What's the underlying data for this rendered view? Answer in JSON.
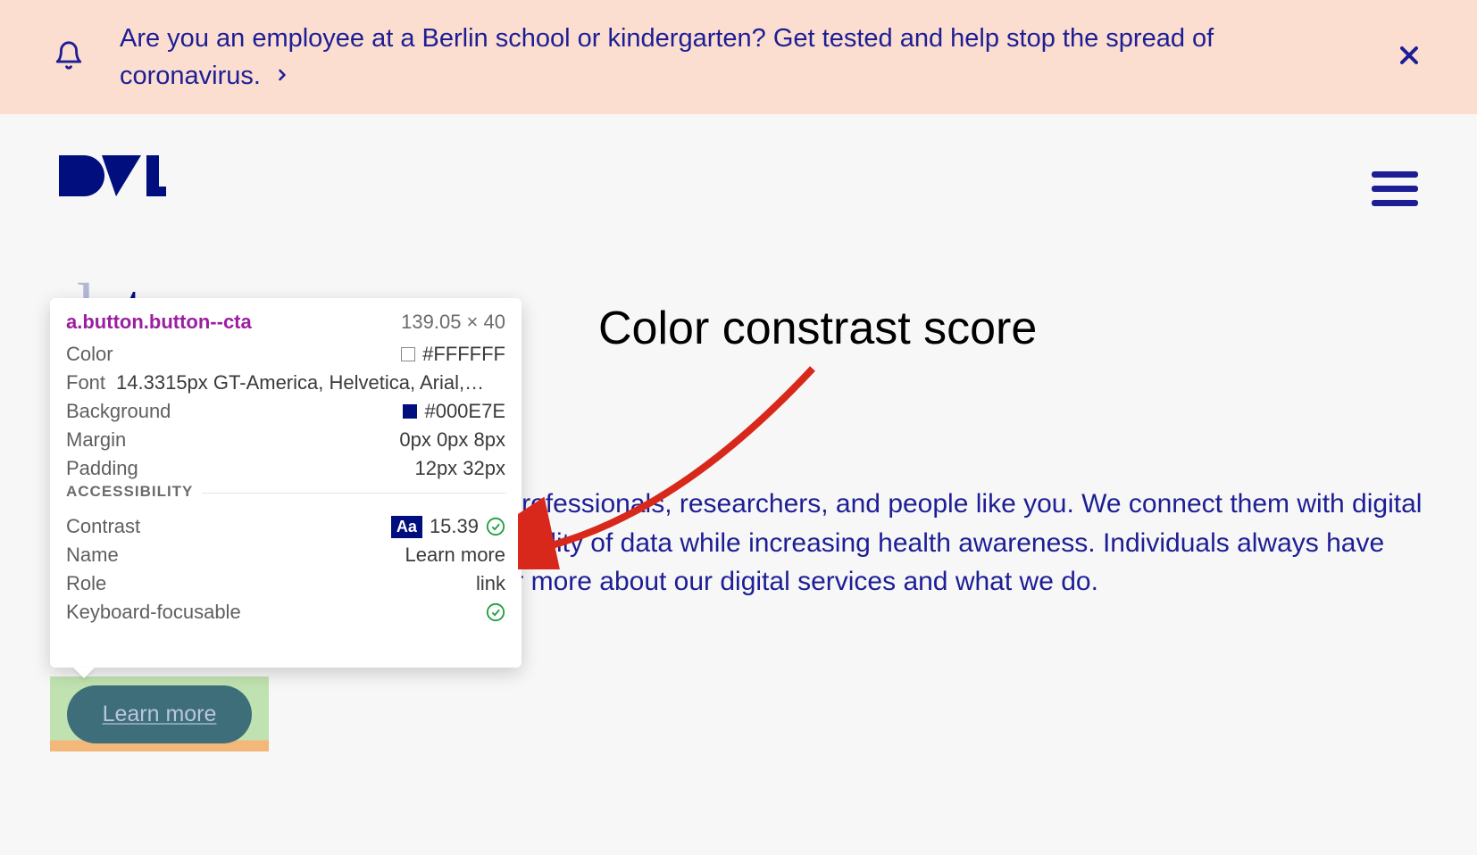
{
  "banner": {
    "message": "Are you an employee at a Berlin school or kindergarten? Get tested and help stop the spread of coronavirus."
  },
  "logo": {
    "text": "D4L"
  },
  "hero": {
    "heading_light": "da",
    "heading_strong": "ta",
    "body": "We build bridges between healthcare professionals, researchers, and people like you. We connect them with digital solutions that improve the secure availability of data while increasing health awareness. Individuals always have complete control of their data. Discover more about our digital services and what we do."
  },
  "cta": {
    "label": "Learn more"
  },
  "tooltip": {
    "selector_tag": "a",
    "selector_classes": ".button.button--cta",
    "dimensions": "139.05 × 40",
    "rows": {
      "color_label": "Color",
      "color_value": "#FFFFFF",
      "font_label": "Font",
      "font_value": "14.3315px GT-America, Helvetica, Arial,…",
      "background_label": "Background",
      "background_value": "#000E7E",
      "margin_label": "Margin",
      "margin_value": "0px 0px 8px",
      "padding_label": "Padding",
      "padding_value": "12px 32px"
    },
    "a11y": {
      "section": "ACCESSIBILITY",
      "contrast_label": "Contrast",
      "aa_badge": "Aa",
      "contrast_value": "15.39",
      "name_label": "Name",
      "name_value": "Learn more",
      "role_label": "Role",
      "role_value": "link",
      "kf_label": "Keyboard-focusable"
    }
  },
  "annotation": {
    "label": "Color constrast score"
  }
}
